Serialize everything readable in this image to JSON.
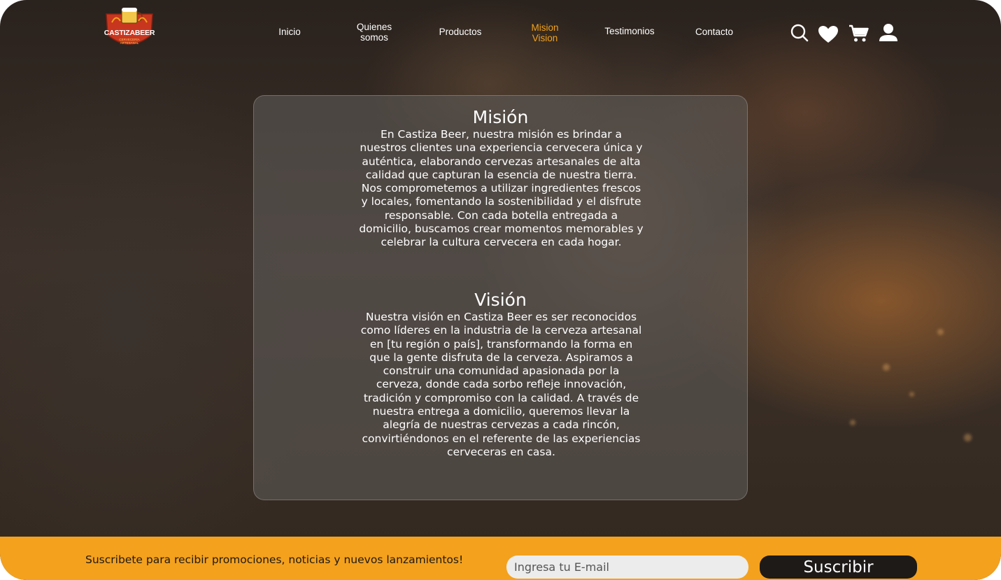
{
  "brand": {
    "logo_text": "CASTIZABEER",
    "logo_subtext": "CERVECERÍA ARTESANAL",
    "colors": {
      "accent": "#f3a21a",
      "logo_red": "#c8361f",
      "band": "#f4a11d",
      "button": "#1d1a18"
    }
  },
  "nav": {
    "items": [
      {
        "line1": "Inicio",
        "line2": ""
      },
      {
        "line1": "Quienes",
        "line2": "somos"
      },
      {
        "line1": "Productos",
        "line2": ""
      },
      {
        "line1": "Mision",
        "line2": "Vision",
        "active": true
      },
      {
        "line1": "Testimonios",
        "line2": ""
      },
      {
        "line1": "Contacto",
        "line2": ""
      }
    ]
  },
  "header_icons": [
    "search-icon",
    "heart-icon",
    "cart-icon",
    "user-icon"
  ],
  "mission": {
    "title": "Misión",
    "body": "En Castiza Beer, nuestra misión es brindar a nuestros clientes una experiencia cervecera única y auténtica, elaborando cervezas artesanales de alta calidad que capturan la esencia de nuestra tierra. Nos comprometemos a utilizar ingredientes frescos y locales, fomentando la sostenibilidad y el disfrute responsable. Con cada botella entregada a domicilio, buscamos crear momentos memorables y celebrar la cultura cervecera en cada hogar."
  },
  "vision": {
    "title": "Visión",
    "body": "Nuestra visión en Castiza Beer es ser reconocidos como líderes en la industria de la cerveza artesanal en [tu región o país], transformando la forma en que la gente disfruta de la cerveza. Aspiramos a construir una comunidad apasionada por la cerveza, donde cada sorbo refleje innovación, tradición y compromiso con la calidad. A través de nuestra entrega a domicilio, queremos llevar la alegría de nuestras cervezas a cada rincón, convirtiéndonos en el referente de las experiencias cerveceras en casa."
  },
  "subscribe": {
    "text": "Suscribete para recibir promociones, noticias y nuevos lanzamientos!",
    "email_placeholder": "Ingresa tu E-mail",
    "button_label": "Suscribir"
  }
}
